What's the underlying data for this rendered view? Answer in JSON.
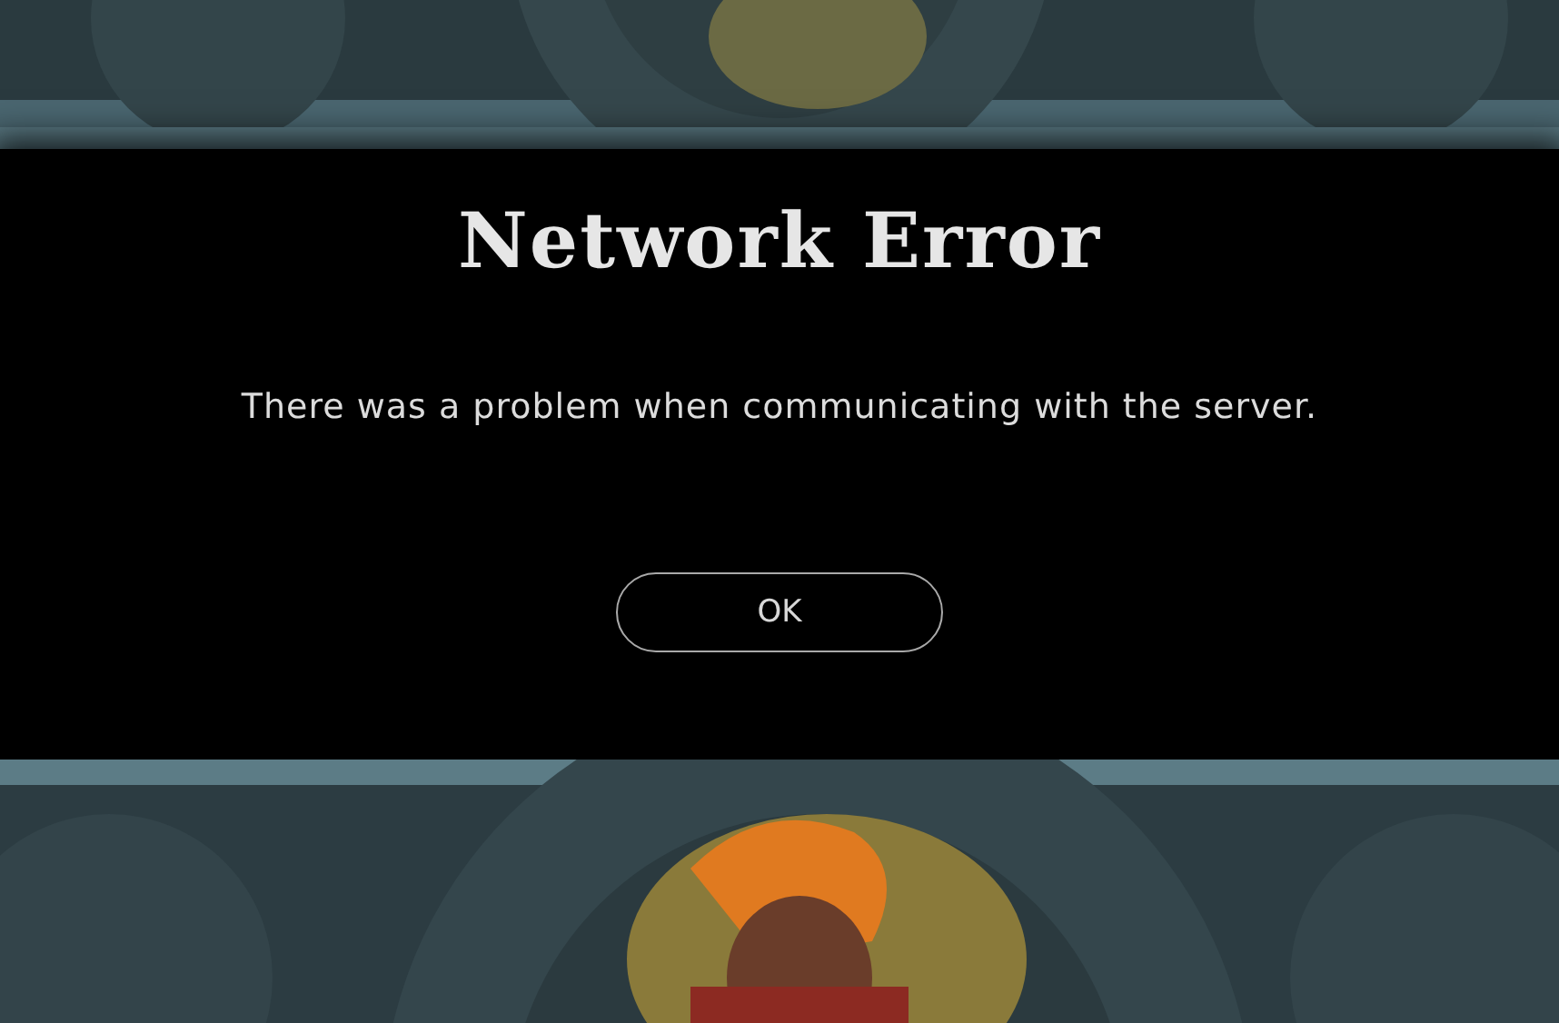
{
  "dialog": {
    "title": "Network Error",
    "message": "There was a problem when communicating with the server.",
    "buttons": [
      "OK"
    ]
  }
}
